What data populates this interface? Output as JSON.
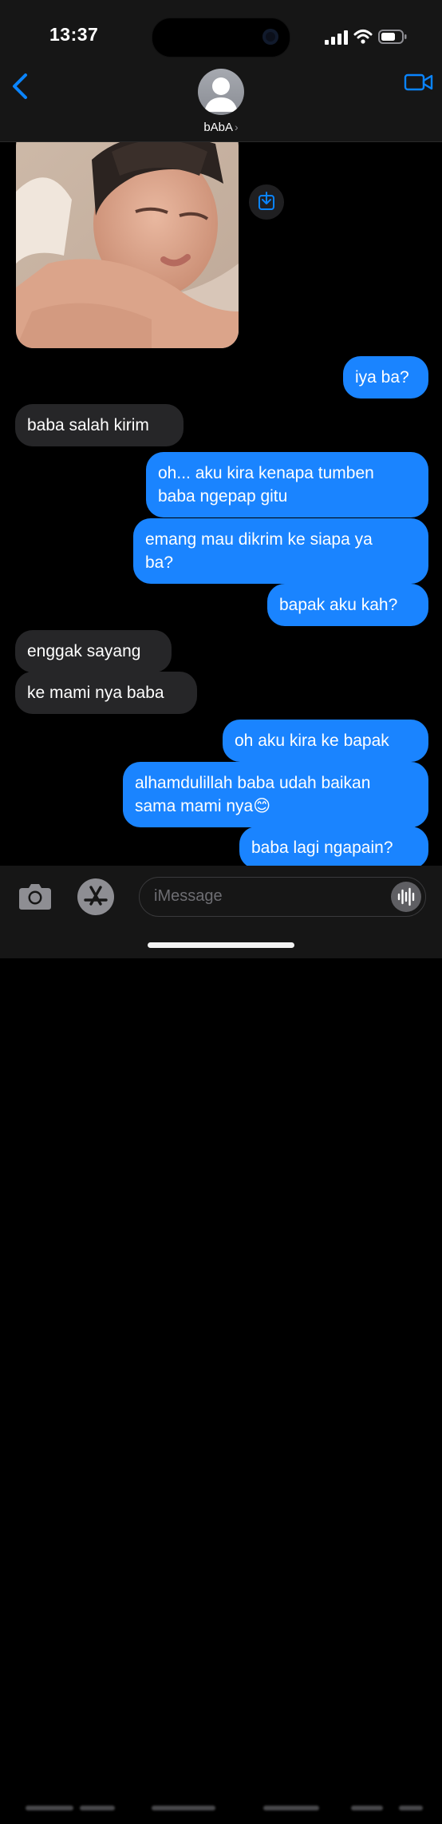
{
  "status_bar": {
    "time": "13:37"
  },
  "header": {
    "contact_name": "bAbA",
    "chevron": "›"
  },
  "messages": [
    {
      "direction": "out",
      "text": "iya ba?"
    },
    {
      "direction": "in",
      "text": "baba salah kirim"
    },
    {
      "direction": "out",
      "text": "oh... aku kira kenapa tumben\nbaba ngepap gitu"
    },
    {
      "direction": "out",
      "text": "emang mau dikrim ke siapa ya\nba?"
    },
    {
      "direction": "out",
      "text": "bapak aku kah?"
    },
    {
      "direction": "in",
      "text": "enggak sayang"
    },
    {
      "direction": "in",
      "text": "ke mami nya baba"
    },
    {
      "direction": "out",
      "text": "oh aku kira ke bapak"
    },
    {
      "direction": "out",
      "text": "alhamdulillah baba udah baikan\nsama mami nya😊"
    },
    {
      "direction": "out",
      "text": "baba lagi ngapain?"
    }
  ],
  "composer": {
    "placeholder": "iMessage"
  },
  "icons": [
    "back-chevron-icon",
    "avatar-person-icon",
    "video-camera-icon",
    "save-download-icon",
    "camera-icon",
    "app-store-icon",
    "audio-waveform-icon"
  ],
  "colors": {
    "outgoing_bubble": "#1a84ff",
    "incoming_bubble": "#262628",
    "accent": "#0a84ff",
    "background": "#000000"
  }
}
